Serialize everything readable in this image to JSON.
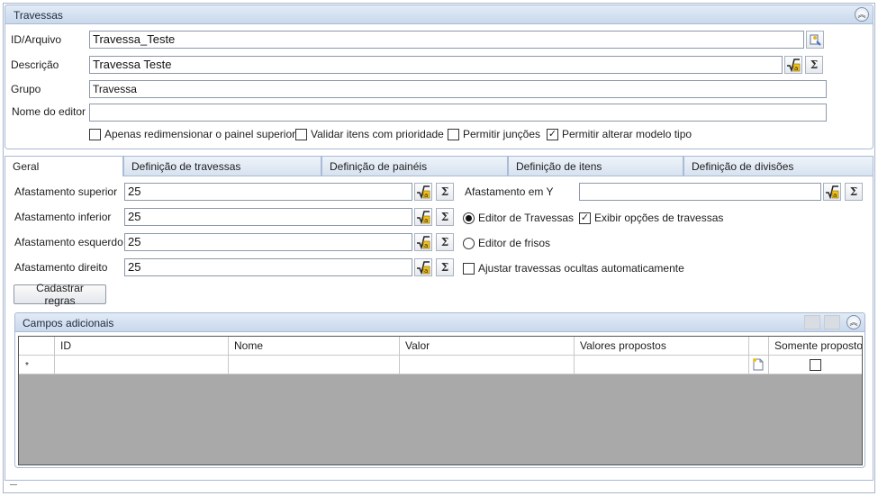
{
  "header": {
    "title": "Travessas"
  },
  "form": {
    "id": {
      "label": "ID/Arquivo",
      "value": "Travessa_Teste"
    },
    "descricao": {
      "label": "Descrição",
      "value": "Travessa Teste"
    },
    "grupo": {
      "label": "Grupo",
      "value": "Travessa"
    },
    "editor": {
      "label": "Nome do editor",
      "value": ""
    }
  },
  "options": {
    "apenas_redim": {
      "label": "Apenas redimensionar o painel superior",
      "checked": false
    },
    "validar_itens": {
      "label": "Validar itens com prioridade",
      "checked": false
    },
    "permitir_juncoes": {
      "label": "Permitir junções",
      "checked": false
    },
    "permitir_alterar": {
      "label": "Permitir alterar modelo tipo",
      "checked": true,
      "mark": "✓"
    }
  },
  "tabs": [
    {
      "label": "Geral",
      "active": true
    },
    {
      "label": "Definição de travessas",
      "active": false
    },
    {
      "label": "Definição de painéis",
      "active": false
    },
    {
      "label": "Definição de itens",
      "active": false
    },
    {
      "label": "Definição de divisões",
      "active": false
    }
  ],
  "geral": {
    "superior": {
      "label": "Afastamento superior",
      "value": "25"
    },
    "inferior": {
      "label": "Afastamento inferior",
      "value": "25"
    },
    "esquerdo": {
      "label": "Afastamento esquerdo",
      "value": "25"
    },
    "direito": {
      "label": "Afastamento direito",
      "value": "25"
    },
    "y": {
      "label": "Afastamento em Y",
      "value": ""
    },
    "editor_travessas": {
      "label": "Editor de Travessas",
      "selected": true
    },
    "exibir_opcoes": {
      "label": "Exibir opções de travessas",
      "checked": true,
      "mark": "✓"
    },
    "editor_frisos": {
      "label": "Editor de frisos",
      "selected": false
    },
    "ajustar_ocultas": {
      "label": "Ajustar travessas ocultas automaticamente",
      "checked": false
    },
    "cadastrar_regras": "Cadastrar regras"
  },
  "campos": {
    "title": "Campos adicionais",
    "columns": [
      "ID",
      "Nome",
      "Valor",
      "Valores propostos",
      "Somente propostos"
    ],
    "new_row_marker": "*"
  },
  "icons": {
    "formula": "formula-icon",
    "sigma": "Σ",
    "collapse": "double-chevron-up-icon",
    "file_browse": "file-browse-icon",
    "new_doc": "new-document-icon"
  },
  "colors": {
    "header_bg": "#cfdcee",
    "border": "#a9bbd6",
    "grid_empty": "#a9a9a9"
  }
}
